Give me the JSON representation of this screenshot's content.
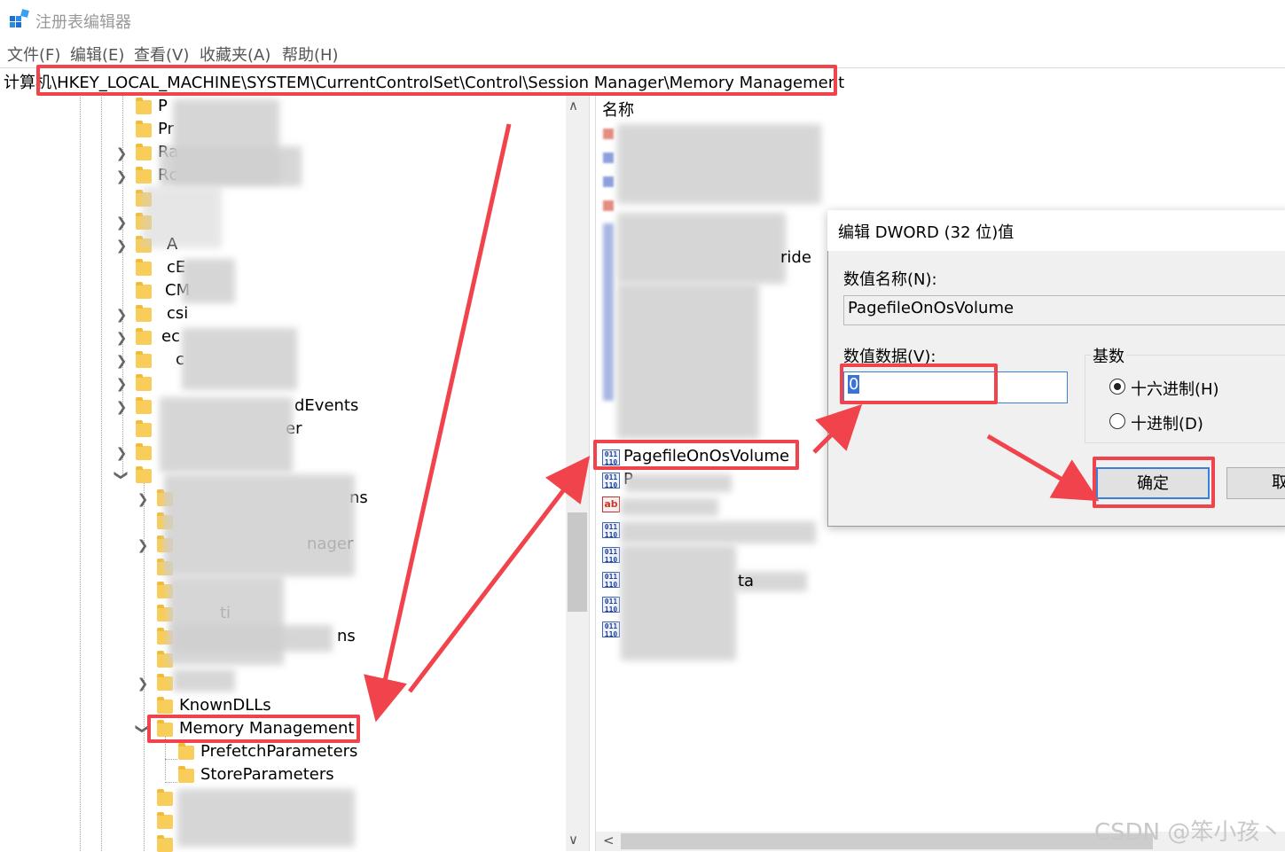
{
  "window": {
    "title": "注册表编辑器"
  },
  "menu": [
    {
      "label": "文件(F)"
    },
    {
      "label": "编辑(E)"
    },
    {
      "label": "查看(V)"
    },
    {
      "label": "收藏夹(A)"
    },
    {
      "label": "帮助(H)"
    }
  ],
  "address": {
    "path": "计算机\\HKEY_LOCAL_MACHINE\\SYSTEM\\CurrentControlSet\\Control\\Session Manager\\Memory Management"
  },
  "tree": {
    "partial_labels": [
      "P",
      "Pr",
      "Ra",
      "Rc",
      "A",
      "cE",
      "CM",
      "csi",
      "ec",
      "c",
      "dEvents",
      "er",
      "ns",
      "nager",
      "ti",
      "ns"
    ],
    "known_dlls": "KnownDLLs",
    "selected": "Memory Management",
    "children": [
      "PrefetchParameters",
      "StoreParameters"
    ]
  },
  "list": {
    "column_name": "名称",
    "partial_labels": [
      "ride",
      "ta"
    ],
    "highlighted_value": "PagefileOnOsVolume",
    "next_value_partial": "P"
  },
  "dialog": {
    "title": "编辑 DWORD (32 位)值",
    "value_name_label": "数值名称(N):",
    "value_name": "PagefileOnOsVolume",
    "value_data_label": "数值数据(V):",
    "value_data": "0",
    "base_label": "基数",
    "base_options": [
      "十六进制(H)",
      "十进制(D)"
    ],
    "base_selected": "十六进制(H)",
    "ok_label": "确定",
    "cancel_label_partial": "取"
  },
  "icons": {
    "dword_icon_text": "011\n110",
    "string_icon_text": "ab"
  },
  "annotation_color": "#f1434c",
  "watermark": "CSDN @笨小孩丶"
}
